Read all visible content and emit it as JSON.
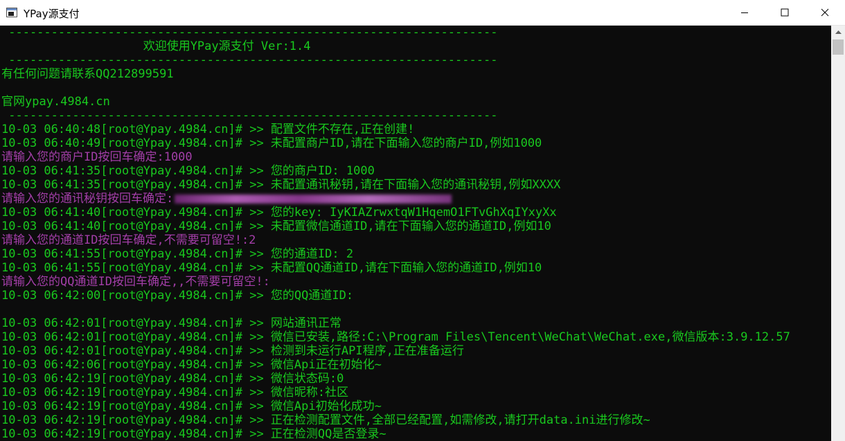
{
  "window": {
    "title": "YPay源支付",
    "icon": "console-window-icon",
    "controls": {
      "minimize": "minimize-icon",
      "maximize": "maximize-icon",
      "close": "close-icon"
    }
  },
  "colors": {
    "background": "#0c0c0c",
    "green": "#19c81e",
    "purple": "#a33ea8"
  },
  "console": {
    "lines": [
      {
        "text": " ---------------------------------------------------------------------",
        "color": "green"
      },
      {
        "text": "                    欢迎使用YPay源支付 Ver:1.4",
        "color": "green"
      },
      {
        "text": " ---------------------------------------------------------------------",
        "color": "green"
      },
      {
        "text": "有任何问题请联系QQ212899591",
        "color": "green"
      },
      {
        "text": "",
        "color": "green"
      },
      {
        "text": "官网ypay.4984.cn",
        "color": "green"
      },
      {
        "text": " ---------------------------------------------------------------------",
        "color": "green"
      },
      {
        "text": "10-03 06:40:48[root@Ypay.4984.cn]# >> 配置文件不存在,正在创建!",
        "color": "green"
      },
      {
        "text": "10-03 06:40:49[root@Ypay.4984.cn]# >> 未配置商户ID,请在下面输入您的商户ID,例如1000",
        "color": "green"
      },
      {
        "text": "请输入您的商户ID按回车确定:1000",
        "color": "purple"
      },
      {
        "text": "10-03 06:41:35[root@Ypay.4984.cn]# >> 您的商户ID: 1000",
        "color": "green"
      },
      {
        "text": "10-03 06:41:35[root@Ypay.4984.cn]# >> 未配置通讯秘钥,请在下面输入您的通讯秘钥,例如XXXX",
        "color": "green"
      },
      {
        "text": "请输入您的通讯秘钥按回车确定:",
        "color": "purple",
        "redacted": true
      },
      {
        "text": "10-03 06:41:40[root@Ypay.4984.cn]# >> 您的key: IyKIAZrwxtqW1HqemO1FTvGhXqIYxyXx",
        "color": "green",
        "partially_obscured": true
      },
      {
        "text": "10-03 06:41:40[root@Ypay.4984.cn]# >> 未配置微信通道ID,请在下面输入您的通道ID,例如10",
        "color": "green"
      },
      {
        "text": "请输入您的通道ID按回车确定,不需要可留空!:2",
        "color": "purple"
      },
      {
        "text": "10-03 06:41:55[root@Ypay.4984.cn]# >> 您的通道ID: 2",
        "color": "green"
      },
      {
        "text": "10-03 06:41:55[root@Ypay.4984.cn]# >> 未配置QQ通道ID,请在下面输入您的通道ID,例如10",
        "color": "green"
      },
      {
        "text": "请输入您的QQ通道ID按回车确定,,不需要可留空!:",
        "color": "purple"
      },
      {
        "text": "10-03 06:42:00[root@Ypay.4984.cn]# >> 您的QQ通道ID:",
        "color": "green"
      },
      {
        "text": "",
        "color": "green"
      },
      {
        "text": "10-03 06:42:01[root@Ypay.4984.cn]# >> 网站通讯正常",
        "color": "green"
      },
      {
        "text": "10-03 06:42:01[root@Ypay.4984.cn]# >> 微信已安装,路径:C:\\Program Files\\Tencent\\WeChat\\WeChat.exe,微信版本:3.9.12.57",
        "color": "green"
      },
      {
        "text": "10-03 06:42:01[root@Ypay.4984.cn]# >> 检测到未运行API程序,正在准备运行",
        "color": "green"
      },
      {
        "text": "10-03 06:42:06[root@Ypay.4984.cn]# >> 微信Api正在初始化~",
        "color": "green"
      },
      {
        "text": "10-03 06:42:19[root@Ypay.4984.cn]# >> 微信状态码:0",
        "color": "green"
      },
      {
        "text": "10-03 06:42:19[root@Ypay.4984.cn]# >> 微信昵称:社区",
        "color": "green"
      },
      {
        "text": "10-03 06:42:19[root@Ypay.4984.cn]# >> 微信Api初始化成功~",
        "color": "green"
      },
      {
        "text": "10-03 06:42:19[root@Ypay.4984.cn]# >> 正在检测配置文件,全部已经配置,如需修改,请打开data.ini进行修改~",
        "color": "green"
      },
      {
        "text": "10-03 06:42:19[root@Ypay.4984.cn]# >> 正在检测QQ是否登录~",
        "color": "green"
      }
    ]
  },
  "scrollbar": {
    "up": "scroll-up-arrow-icon"
  }
}
